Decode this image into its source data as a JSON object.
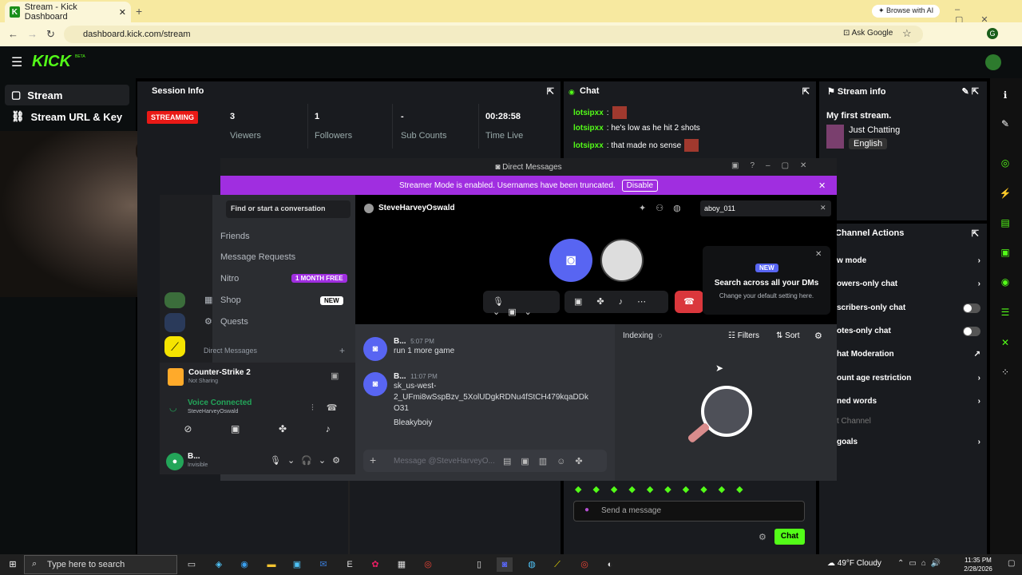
{
  "browser": {
    "tab_title": "Stream - Kick Dashboard",
    "url": "dashboard.kick.com/stream",
    "browse_ai": "Browse with AI",
    "ask_google": "Ask Google",
    "profile": "G"
  },
  "kick": {
    "logo": "KICK",
    "beta": "BETA",
    "nav": [
      {
        "label": "Stream"
      },
      {
        "label": "Stream URL & Key"
      }
    ],
    "session": {
      "title": "Session Info",
      "status": "STREAMING",
      "stats": [
        {
          "value": "3",
          "label": "Viewers"
        },
        {
          "value": "1",
          "label": "Followers"
        },
        {
          "value": "-",
          "label": "Sub Counts"
        },
        {
          "value": "00:28:58",
          "label": "Time Live"
        }
      ]
    },
    "chat": {
      "title": "Chat",
      "messages": [
        {
          "user": "lotsipxx",
          "text": ":"
        },
        {
          "user": "lotsipxx",
          "text": ": he's low as he hit 2 shots"
        },
        {
          "user": "lotsipxx",
          "text": ": that made no sense"
        }
      ],
      "input_placeholder": "Send a message",
      "send": "Chat"
    },
    "stream_info": {
      "title": "Stream info",
      "stream_title": "My first stream.",
      "category": "Just Chatting",
      "language": "English"
    },
    "channel_actions": {
      "title": "Channel Actions",
      "items": [
        {
          "label": "w mode"
        },
        {
          "label": "owers-only chat"
        },
        {
          "label": "scribers-only chat"
        },
        {
          "label": "otes-only chat"
        },
        {
          "label": "hat Moderation"
        },
        {
          "label": "ount age restriction"
        },
        {
          "label": "ned words"
        },
        {
          "label": "t Channel"
        },
        {
          "label": "goals"
        }
      ]
    }
  },
  "discord": {
    "window_title": "Direct Messages",
    "streamer_text": "Streamer Mode is enabled. Usernames have been truncated.",
    "disable": "Disable",
    "find": "Find or start a conversation",
    "nav": [
      {
        "label": "Friends"
      },
      {
        "label": "Message Requests"
      },
      {
        "label": "Nitro",
        "badge": "1 MONTH FREE"
      },
      {
        "label": "Shop",
        "badge": "NEW"
      },
      {
        "label": "Quests"
      }
    ],
    "dm_header": "Direct Messages",
    "game": {
      "name": "Counter-Strike 2",
      "sub": "Not Sharing"
    },
    "voice": {
      "status": "Voice Connected",
      "user": "SteveHarveyOswald"
    },
    "me": {
      "name": "B...",
      "status": "Invisible"
    },
    "call_user": "SteveHarveyOswald",
    "search_value": "aboy_011",
    "popup": {
      "badge": "NEW",
      "title": "Search across all your DMs",
      "sub": "Change your default setting here."
    },
    "messages": [
      {
        "name": "B...",
        "time": "5:07 PM",
        "lines": [
          "run 1 more game"
        ]
      },
      {
        "name": "B...",
        "time": "11:07 PM",
        "lines": [
          "sk_us-west-",
          "2_UFmi8wSspBzv_5XolUDgkRDNu4fStCH479kqaDDk",
          "O31",
          "Bleakyboiy"
        ]
      }
    ],
    "composer": "Message @SteveHarveyO...",
    "search_panel": {
      "indexing": "Indexing",
      "filters": "Filters",
      "sort": "Sort"
    }
  },
  "taskbar": {
    "search": "Type here to search",
    "weather": "49°F  Cloudy",
    "time": "11:35 PM",
    "date": "2/28/2026"
  }
}
